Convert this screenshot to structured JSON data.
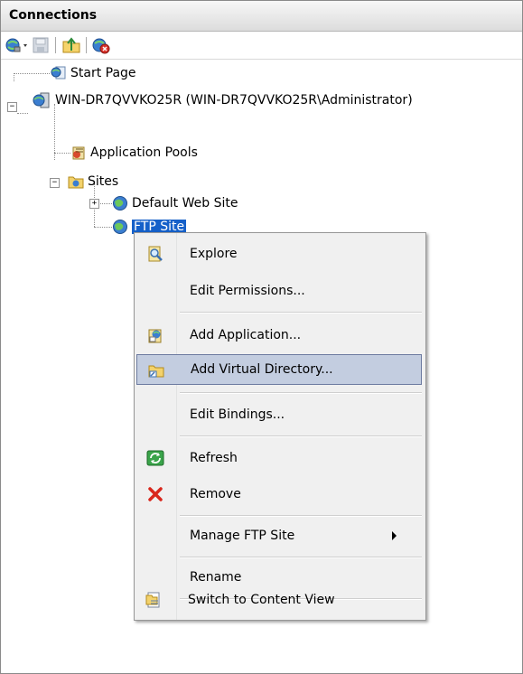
{
  "panel": {
    "title": "Connections"
  },
  "toolbar": {
    "buttons": [
      "globe-connect-icon",
      "save-icon",
      "folder-up-icon",
      "disconnect-icon"
    ]
  },
  "tree": {
    "start_page": "Start Page",
    "server": "WIN-DR7QVVKO25R (WIN-DR7QVVKO25R\\Administrator)",
    "app_pools": "Application Pools",
    "sites": "Sites",
    "default_site": "Default Web Site",
    "ftp_site": "FTP Site"
  },
  "context_menu": {
    "items": [
      {
        "label": "Explore",
        "icon": "explore-icon"
      },
      {
        "label": "Edit Permissions..."
      },
      {
        "label": "Add Application...",
        "icon": "add-application-icon"
      },
      {
        "label": "Add Virtual Directory...",
        "icon": "add-virtual-directory-icon",
        "highlighted": true
      },
      {
        "label": "Edit Bindings..."
      },
      {
        "label": "Refresh",
        "icon": "refresh-icon"
      },
      {
        "label": "Remove",
        "icon": "remove-icon"
      },
      {
        "label": "Manage FTP Site",
        "submenu": true
      },
      {
        "label": "Rename"
      },
      {
        "label": "Switch to Content View",
        "icon": "content-view-icon"
      }
    ]
  },
  "colors": {
    "selection": "#1560c9",
    "menu_highlight": "#c3cde0"
  }
}
